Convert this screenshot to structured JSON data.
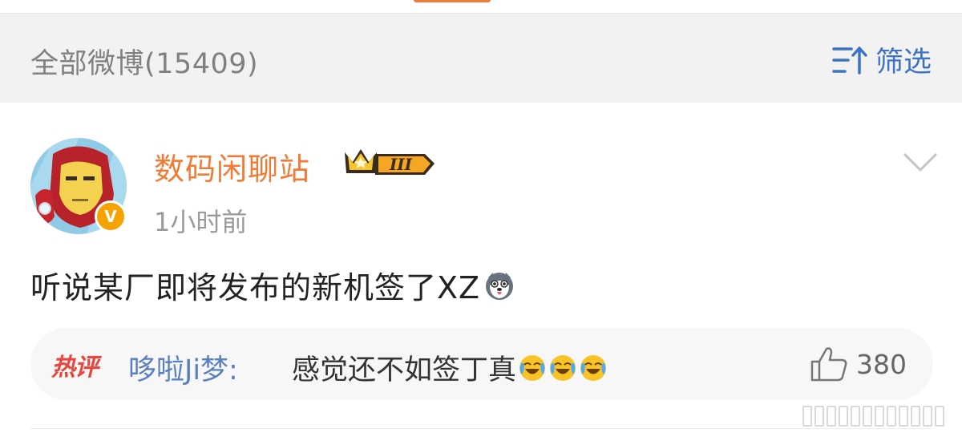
{
  "filter_bar": {
    "title": "全部微博(15409)",
    "filter_label": "筛选",
    "filter_icon": "sort-up-icon"
  },
  "post": {
    "username": "数码闲聊站",
    "level_badge_text": "III",
    "verified_icon": "verified-v-icon",
    "timestamp": "1小时前",
    "content": "听说某厂即将发布的新机签了XZ",
    "content_emoji": "husky-dog-emoji",
    "hot_comment": {
      "tag": "热评",
      "user": "哆啦Ji梦",
      "separator": ":",
      "text": "感觉还不如签丁真",
      "emoji": "laugh-cry-emoji",
      "emoji_count": 3,
      "like_count": "380"
    }
  },
  "colors": {
    "accent_orange": "#f07b35",
    "link_blue": "#3d73c7",
    "comment_user_blue": "#5a7fc0",
    "hot_red": "#e8453c",
    "verify_gold": "#f5a300"
  }
}
